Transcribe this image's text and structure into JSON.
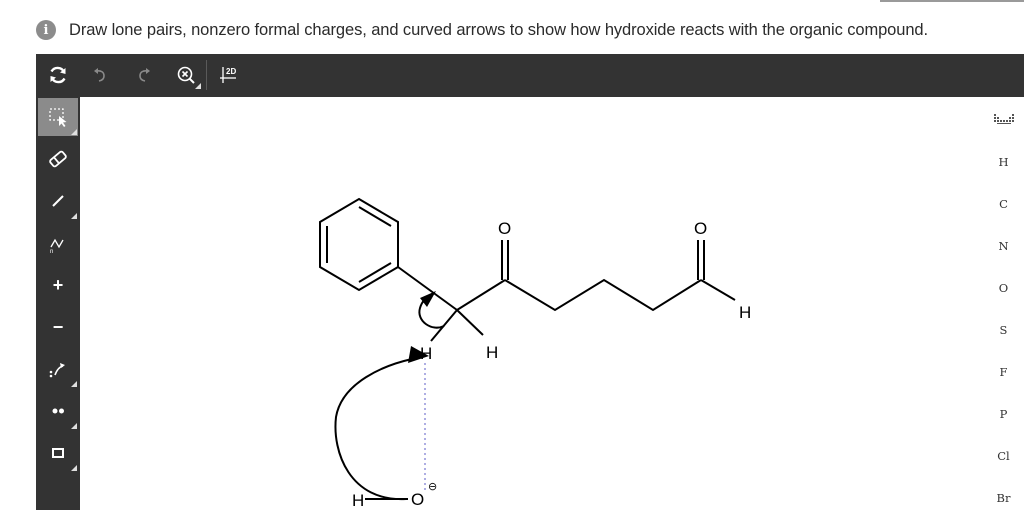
{
  "question": {
    "info_icon": "i",
    "text": "Draw lone pairs, nonzero formal charges, and curved arrows to show how hydroxide reacts with the organic compound."
  },
  "top_toolbar": {
    "items": [
      {
        "name": "clear-canvas-button",
        "icon": "refresh-icon"
      },
      {
        "name": "undo-button",
        "icon": "undo-icon"
      },
      {
        "name": "redo-button",
        "icon": "redo-icon"
      },
      {
        "name": "zoom-button",
        "icon": "zoom-close-icon"
      },
      {
        "name": "clean-2d-button",
        "icon": "clean-2d-icon",
        "label": "2D"
      }
    ]
  },
  "left_tools": {
    "items": [
      {
        "name": "select-tool",
        "icon": "select-icon",
        "active": true
      },
      {
        "name": "eraser-tool",
        "icon": "eraser-icon"
      },
      {
        "name": "bond-tool",
        "icon": "single-bond-icon"
      },
      {
        "name": "chain-tool",
        "icon": "chain-icon"
      },
      {
        "name": "positive-charge-tool",
        "icon": "plus-icon",
        "label": "+"
      },
      {
        "name": "negative-charge-tool",
        "icon": "minus-icon",
        "label": "−"
      },
      {
        "name": "curved-arrow-tool",
        "icon": "curved-arrow-icon"
      },
      {
        "name": "lone-pair-tool",
        "icon": "lone-pair-icon"
      },
      {
        "name": "shape-tool",
        "icon": "rectangle-icon"
      }
    ]
  },
  "atom_palette": {
    "periodic_table_icon": "periodic-table-icon",
    "items": [
      "H",
      "C",
      "N",
      "O",
      "S",
      "F",
      "P",
      "Cl",
      "Br"
    ]
  },
  "molecule": {
    "labels": {
      "oxygen_1": "O",
      "oxygen_2": "O",
      "aldehyde_h": "H",
      "alpha_h_1": "H",
      "alpha_h_2": "H",
      "hydroxide_o": "O",
      "hydroxide_h": "H",
      "charge": "⊖"
    },
    "colors": {
      "bond": "#000000",
      "interaction_dots": "#9a9adc"
    }
  }
}
